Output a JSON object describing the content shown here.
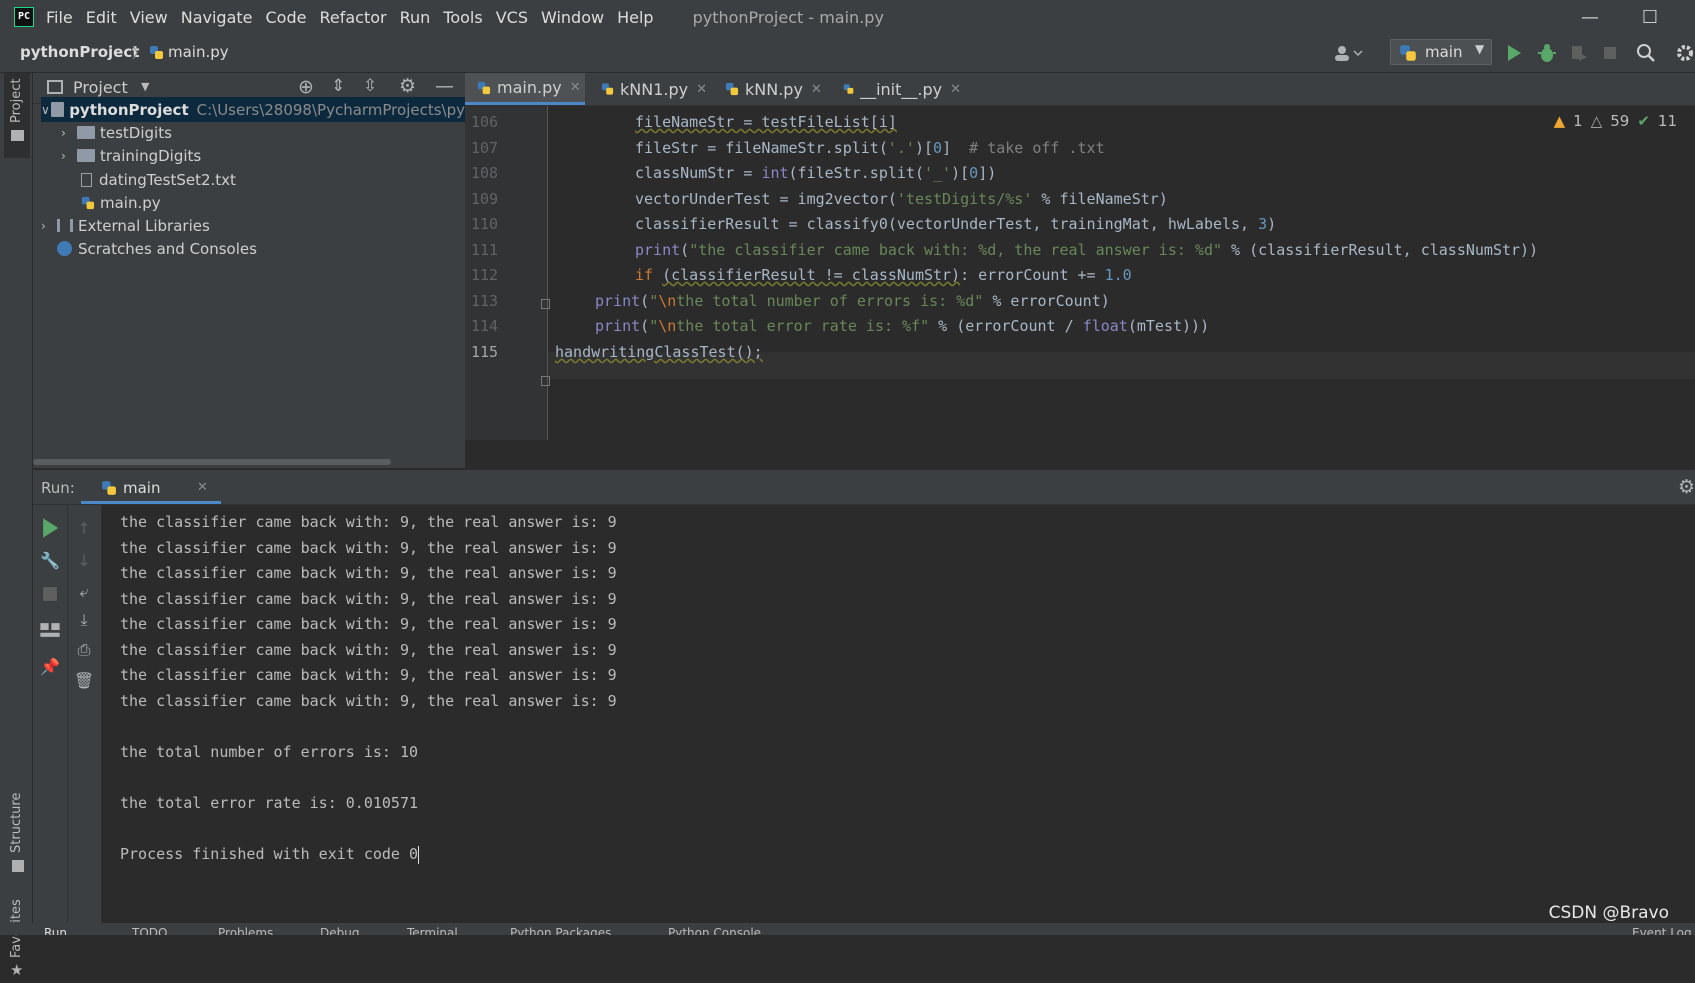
{
  "menu": {
    "items": [
      "File",
      "Edit",
      "View",
      "Navigate",
      "Code",
      "Refactor",
      "Run",
      "Tools",
      "VCS",
      "Window",
      "Help"
    ],
    "window_title": "pythonProject - main.py"
  },
  "navbar": {
    "project": "pythonProject",
    "file": "main.py",
    "run_config": "main"
  },
  "project_panel": {
    "title": "Project",
    "tree": [
      {
        "label": "pythonProject",
        "path": "C:\\Users\\28098\\PycharmProjects\\py"
      },
      {
        "label": "testDigits"
      },
      {
        "label": "trainingDigits"
      },
      {
        "label": "datingTestSet2.txt"
      },
      {
        "label": "main.py"
      },
      {
        "label": "External Libraries"
      },
      {
        "label": "Scratches and Consoles"
      }
    ]
  },
  "editor": {
    "tabs": [
      "main.py",
      "kNN1.py",
      "kNN.py",
      "__init__.py"
    ],
    "inspections": {
      "warnings": "1",
      "weak_warnings": "59",
      "typos": "11"
    },
    "line_numbers": [
      "106",
      "107",
      "108",
      "109",
      "110",
      "111",
      "112",
      "113",
      "114",
      "115"
    ],
    "code": {
      "l106": "fileNameStr = testFileList[i]",
      "l107_a": "fileStr = fileNameStr.split(",
      "l107_b": "'.'",
      "l107_c": ")[",
      "l107_d": "0",
      "l107_e": "]  ",
      "l107_f": "# take off .txt",
      "l108_a": "classNumStr = ",
      "l108_b": "int",
      "l108_c": "(fileStr.split(",
      "l108_d": "'_'",
      "l108_e": ")[",
      "l108_f": "0",
      "l108_g": "])",
      "l109_a": "vectorUnderTest = img2vector(",
      "l109_b": "'testDigits/%s'",
      "l109_c": " % fileNameStr)",
      "l110_a": "classifierResult = classify0(vectorUnderTest, trainingMat, hwLabels, ",
      "l110_b": "3",
      "l110_c": ")",
      "l111_a": "print",
      "l111_b": "(",
      "l111_c": "\"the classifier came back with: %d, the real answer is: %d\"",
      "l111_d": " % (classifierResult, classNumStr))",
      "l112_a": "if ",
      "l112_b": "(classifierResult != classNumStr)",
      "l112_c": ": errorCount += ",
      "l112_d": "1.0",
      "l113_a": "print",
      "l113_b": "(",
      "l113_c": "\"",
      "l113_d": "\\n",
      "l113_e": "the total number of errors is: %d\"",
      "l113_f": " % errorCount)",
      "l114_a": "print",
      "l114_b": "(",
      "l114_c": "\"",
      "l114_d": "\\n",
      "l114_e": "the total error rate is: %f\"",
      "l114_f": " % (errorCount / ",
      "l114_g": "float",
      "l114_h": "(mTest)))",
      "l115": "handwritingClassTest();"
    }
  },
  "run_panel": {
    "label": "Run:",
    "tab": "main",
    "console": [
      "the classifier came back with: 9, the real answer is: 9",
      "the classifier came back with: 9, the real answer is: 9",
      "the classifier came back with: 9, the real answer is: 9",
      "the classifier came back with: 9, the real answer is: 9",
      "the classifier came back with: 9, the real answer is: 9",
      "the classifier came back with: 9, the real answer is: 9",
      "the classifier came back with: 9, the real answer is: 9",
      "the classifier came back with: 9, the real answer is: 9",
      "",
      "the total number of errors is: 10",
      "",
      "the total error rate is: 0.010571",
      "",
      "Process finished with exit code 0"
    ]
  },
  "side_tabs": {
    "project": "Project",
    "structure": "Structure",
    "favorites": "Favorites"
  },
  "bottom_bar": [
    "Run",
    "TODO",
    "Problems",
    "Debug",
    "Terminal",
    "Python Packages",
    "Python Console",
    "Event Log"
  ],
  "watermark": "CSDN @Bravo ",
  "colors": {
    "accent": "#4a88c7",
    "run_green": "#59a869",
    "keyword": "#cc7832",
    "string": "#6a8759"
  }
}
